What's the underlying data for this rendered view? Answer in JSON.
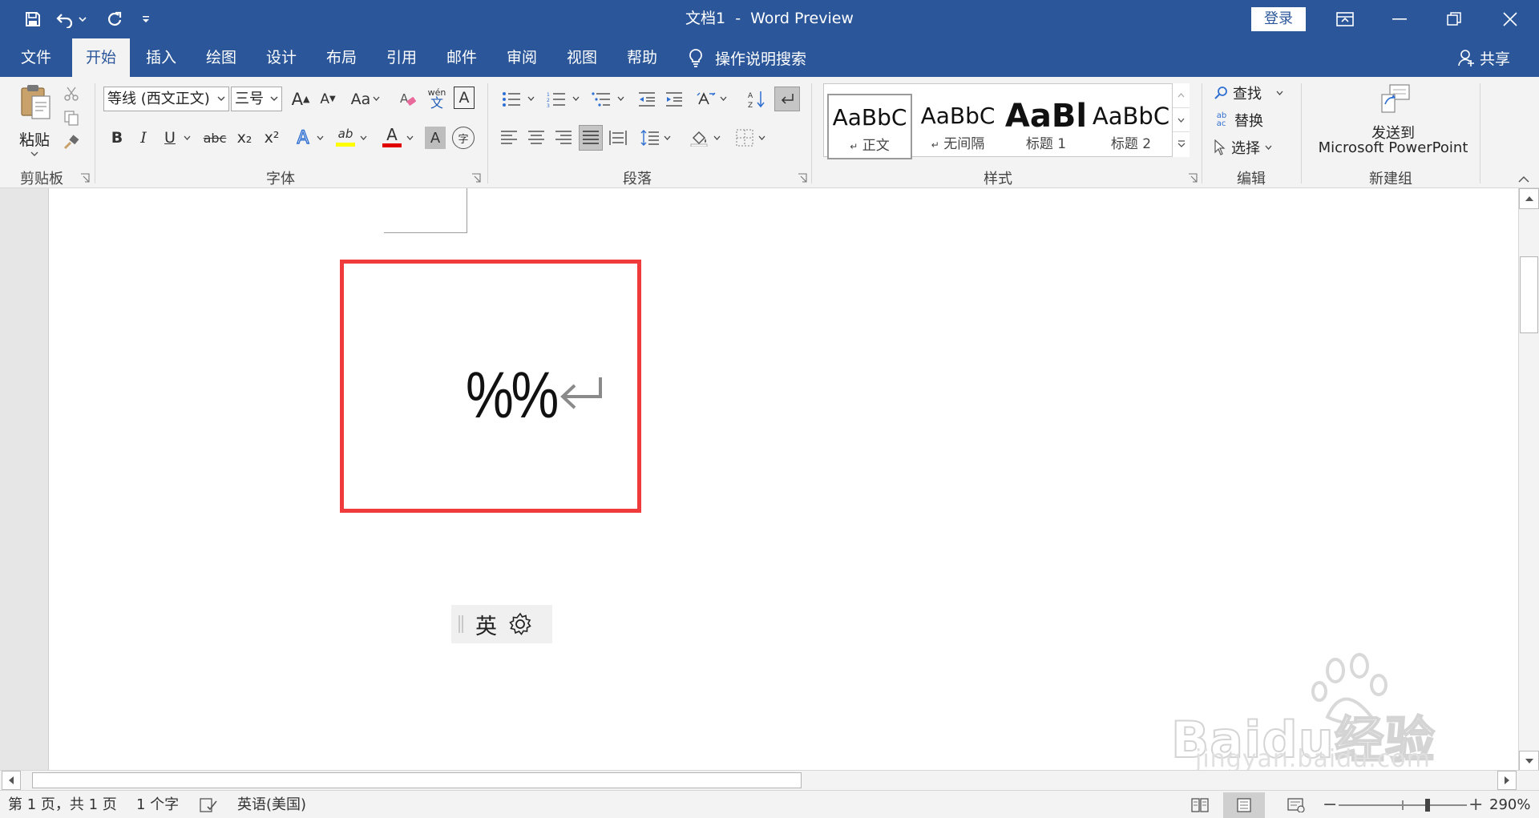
{
  "window": {
    "title": "文档1  -  Word Preview",
    "login_label": "登录"
  },
  "colors": {
    "brand": "#2b579a",
    "highlight_box": "#ef3b3b",
    "highlight_yellow": "#ffff00",
    "font_color_red": "#e00000"
  },
  "tabs": [
    "文件",
    "开始",
    "插入",
    "绘图",
    "设计",
    "布局",
    "引用",
    "邮件",
    "审阅",
    "视图",
    "帮助"
  ],
  "active_tab": "开始",
  "tell_me": {
    "label": "操作说明搜索",
    "icon": "lightbulb-icon"
  },
  "share_label": "共享",
  "clipboard": {
    "paste_label": "粘贴",
    "group_label": "剪贴板"
  },
  "font": {
    "name": "等线 (西文正文)",
    "size": "三号",
    "phonetic_top": "wén",
    "phonetic_bottom": "文",
    "change_case": "Aa",
    "bold": "B",
    "italic": "I",
    "underline": "U",
    "strike": "abc",
    "grow_letter": "A",
    "shrink_letter": "A",
    "subscript": "x₂",
    "superscript": "x²",
    "text_effect": "A",
    "highlight_text": "ab",
    "font_color": "A",
    "char_shading": "A",
    "enclose_char": "字",
    "border_char": "A",
    "group_label": "字体"
  },
  "paragraph": {
    "group_label": "段落"
  },
  "styles": {
    "items": [
      {
        "preview": "AaBbC",
        "name": "正文",
        "mark": "↵",
        "selected": true
      },
      {
        "preview": "AaBbC",
        "name": "无间隔",
        "mark": "↵",
        "selected": false
      },
      {
        "preview": "AaBl",
        "name": "标题 1",
        "mark": "",
        "selected": false
      },
      {
        "preview": "AaBbC",
        "name": "标题 2",
        "mark": "",
        "selected": false
      }
    ],
    "group_label": "样式"
  },
  "editing": {
    "find_label": "查找",
    "replace_label": "替换",
    "select_label": "选择",
    "replace_icon_text": "ab\nac",
    "group_label": "编辑"
  },
  "new_group": {
    "send_label_line1": "发送到",
    "send_label_line2": "Microsoft PowerPoint",
    "group_label": "新建组"
  },
  "document": {
    "content": "%%",
    "paragraph_mark": "↵"
  },
  "ime": {
    "mode_label": "英",
    "icon": "gear-icon"
  },
  "watermark": {
    "brand": "Baidu经验",
    "url": "jingyan.baidu.com"
  },
  "status": {
    "page": "第 1 页，共 1 页",
    "words": "1 个字",
    "language": "英语(美国)",
    "zoom": "290%",
    "zoom_minus": "−",
    "zoom_plus": "+"
  }
}
